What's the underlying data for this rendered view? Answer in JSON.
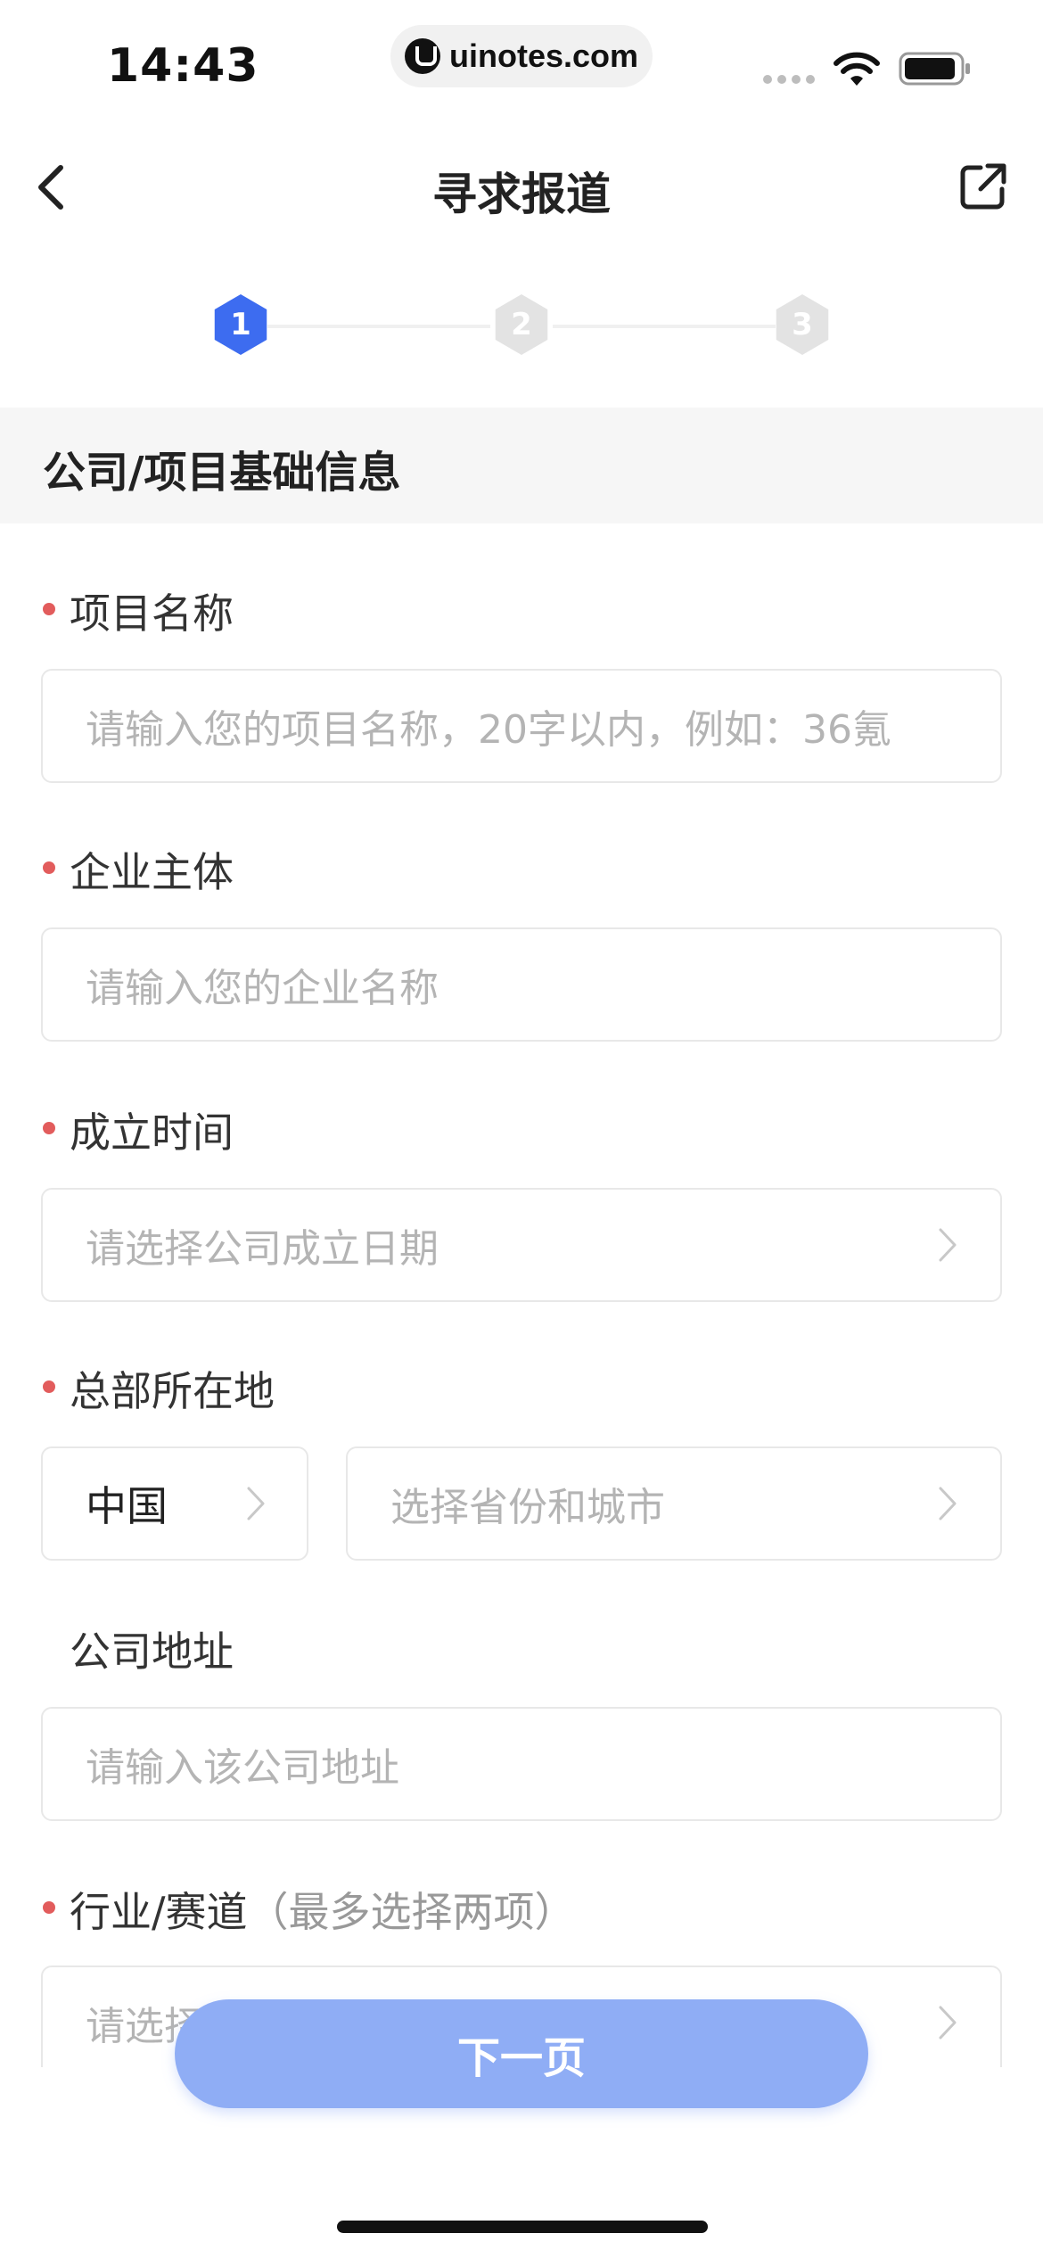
{
  "status_bar": {
    "time": "14:43",
    "url": "uinotes.com"
  },
  "nav": {
    "title": "寻求报道"
  },
  "stepper": {
    "steps": [
      "1",
      "2",
      "3"
    ],
    "active_step": 1,
    "active_color": "#3d6cf0",
    "inactive_color": "#e3e3e3"
  },
  "section": {
    "title": "公司/项目基础信息"
  },
  "form": {
    "project_name": {
      "label": "项目名称",
      "required": true,
      "placeholder": "请输入您的项目名称，20字以内，例如：36氪"
    },
    "company": {
      "label": "企业主体",
      "required": true,
      "placeholder": "请输入您的企业名称"
    },
    "founded": {
      "label": "成立时间",
      "required": true,
      "placeholder": "请选择公司成立日期"
    },
    "hq": {
      "label": "总部所在地",
      "required": true,
      "country_value": "中国",
      "city_placeholder": "选择省份和城市"
    },
    "address": {
      "label": "公司地址",
      "required": false,
      "placeholder": "请输入该公司地址"
    },
    "industry": {
      "label": "行业/赛道",
      "hint": "（最多选择两项）",
      "required": true,
      "placeholder": "请选择"
    }
  },
  "footer": {
    "next_label": "下一页"
  },
  "colors": {
    "required_dot": "#e25c5c",
    "button": "#8fadf5"
  }
}
